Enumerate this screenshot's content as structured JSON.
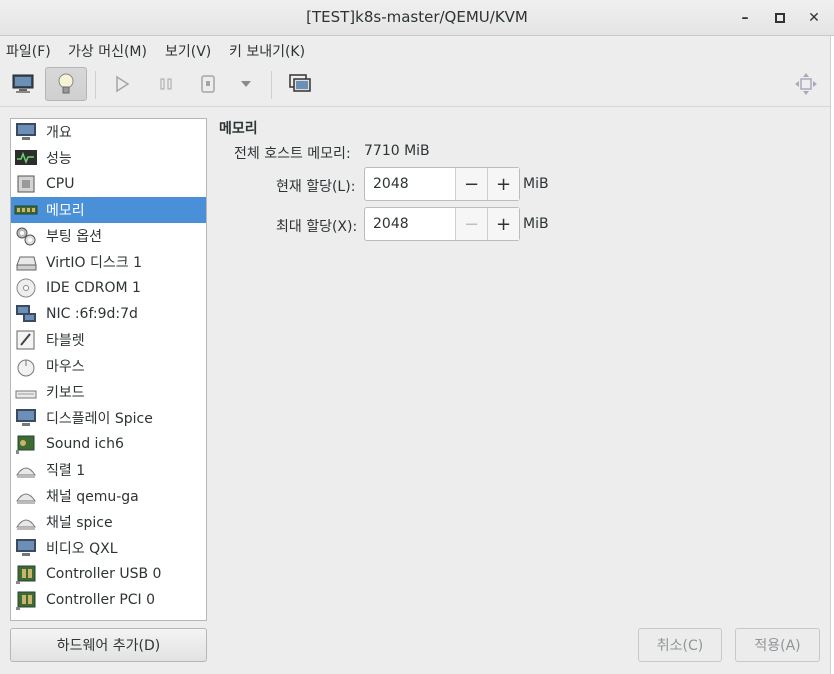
{
  "window": {
    "title": "[TEST]k8s-master/QEMU/KVM",
    "minimize": "–",
    "maximize": "□",
    "close": "✕"
  },
  "menu": [
    "파일(F)",
    "가상 머신(M)",
    "보기(V)",
    "키 보내기(K)"
  ],
  "toolbar": {
    "icons": [
      "monitor-icon",
      "lightbulb-icon",
      "play-icon",
      "pause-icon",
      "power-icon",
      "dropdown-icon",
      "snapshot-icon",
      "fullscreen-icon"
    ]
  },
  "sidebar": {
    "items": [
      {
        "label": "개요",
        "icon": "monitor-icon"
      },
      {
        "label": "성능",
        "icon": "performance-graph-icon"
      },
      {
        "label": "CPU",
        "icon": "cpu-chip-icon"
      },
      {
        "label": "메모리",
        "icon": "memory-icon",
        "selected": true
      },
      {
        "label": "부팅 옵션",
        "icon": "gears-icon"
      },
      {
        "label": "VirtIO 디스크 1",
        "icon": "hard-disk-icon"
      },
      {
        "label": "IDE CDROM 1",
        "icon": "cdrom-icon"
      },
      {
        "label": "NIC :6f:9d:7d",
        "icon": "network-icon"
      },
      {
        "label": "타블렛",
        "icon": "tablet-icon"
      },
      {
        "label": "마우스",
        "icon": "mouse-icon"
      },
      {
        "label": "키보드",
        "icon": "keyboard-icon"
      },
      {
        "label": "디스플레이 Spice",
        "icon": "display-icon"
      },
      {
        "label": "Sound ich6",
        "icon": "sound-card-icon"
      },
      {
        "label": "직렬 1",
        "icon": "serial-icon"
      },
      {
        "label": "채널 qemu-ga",
        "icon": "channel-icon"
      },
      {
        "label": "채널 spice",
        "icon": "channel-icon"
      },
      {
        "label": "비디오 QXL",
        "icon": "video-icon"
      },
      {
        "label": "Controller USB 0",
        "icon": "controller-icon"
      },
      {
        "label": "Controller PCI 0",
        "icon": "controller-icon"
      }
    ],
    "add_hardware": "하드웨어 추가(D)"
  },
  "memory": {
    "title": "메모리",
    "host_total_label": "전체 호스트 메모리:",
    "host_total_value": "7710 MiB",
    "current_label": "현재 할당(L):",
    "current_value": "2048",
    "max_label": "최대 할당(X):",
    "max_value": "2048",
    "unit": "MiB",
    "minus": "−",
    "plus": "+"
  },
  "footer": {
    "cancel": "취소(C)",
    "apply": "적용(A)"
  },
  "colors": {
    "selection": "#4a90d9",
    "background": "#ededed"
  }
}
